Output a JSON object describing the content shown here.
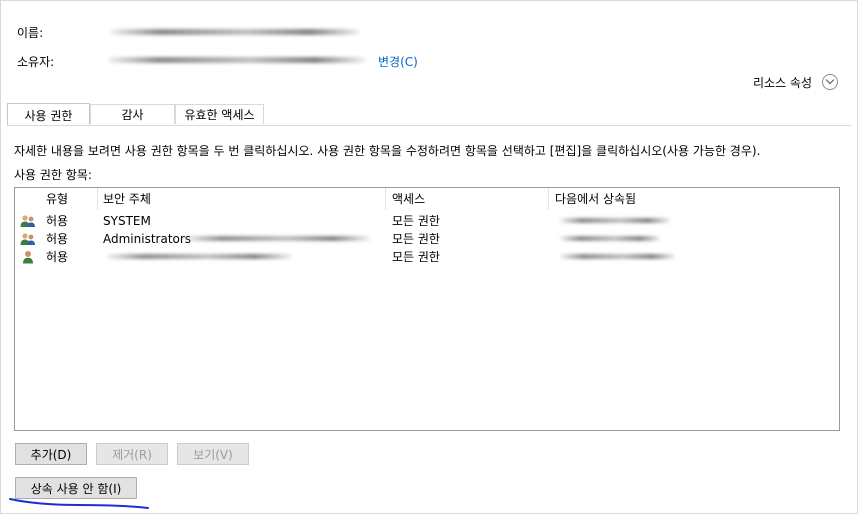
{
  "header": {
    "name_label": "이름:",
    "owner_label": "소유자:",
    "change_link": "변경(C)",
    "resource_props": "리소스 속성"
  },
  "tabs": [
    {
      "label": "사용 권한",
      "active": true
    },
    {
      "label": "감사",
      "active": false
    },
    {
      "label": "유효한 액세스",
      "active": false
    }
  ],
  "panel": {
    "description": "자세한 내용을 보려면 사용 권한 항목을 두 번 클릭하십시오. 사용 권한 항목을 수정하려면 항목을 선택하고 [편집]을 클릭하십시오(사용 가능한 경우).",
    "entries_label": "사용 권한 항목:"
  },
  "table": {
    "columns": [
      "유형",
      "보안 주체",
      "액세스",
      "다음에서 상속됨"
    ],
    "rows": [
      {
        "icon": "group-users-icon",
        "type": "허용",
        "principal": "SYSTEM",
        "access": "모든 권한"
      },
      {
        "icon": "group-users-icon",
        "type": "허용",
        "principal": "Administrators",
        "access": "모든 권한"
      },
      {
        "icon": "single-user-icon",
        "type": "허용",
        "principal": "",
        "access": "모든 권한"
      }
    ]
  },
  "buttons": {
    "add": "추가(D)",
    "remove": "제거(R)",
    "view": "보기(V)",
    "disable_inheritance": "상속 사용 안 함(I)"
  },
  "colors": {
    "link": "#0066cc",
    "annotation_ink": "#1c2fd6",
    "border": "#999999"
  }
}
